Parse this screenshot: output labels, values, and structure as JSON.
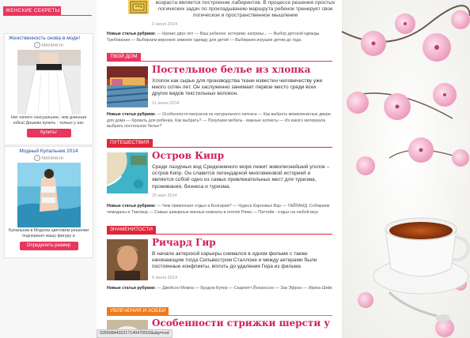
{
  "sidebar": {
    "header": "Женские секреты",
    "ads": [
      {
        "title": "Женственность снова в моде!",
        "source": "lascana.ru",
        "desc": "Нет ничего сексуальнее, чем длинная юбка! Дешево купить - только у нас",
        "button": "Купить!"
      },
      {
        "title": "Модный Купальник 2014",
        "source": "lascana.ru",
        "desc": "Купальник в Модном цветовом решении подчеркнет вашу фигуру и",
        "button": "Определить размер"
      }
    ]
  },
  "main": {
    "intro": {
      "text": "возраста является построение лабиринтов. В процессе решения простых логических задач по прокладыванию маршрута ребенок тренирует свое логическое и пространственное мышление",
      "date": "3 июня 2014",
      "rubrics_label": "Новые статьи рубрики:",
      "rubrics": "— Кризис двух лет — Ваш ребенок: истерики, капризы... — Выбор детской одежды. Требования — Выбираем верхнюю зимнюю одежду для детей — Выбираем игрушки детям до года"
    },
    "articles": [
      {
        "label": "Твой дом",
        "title": "Постельное белье из хлопка",
        "text": "Хлопок как сырье для производства ткани известен человечеству уже много сотен лет. Он заслуженно занимает первое место среди всех других видов текстильных волокон.",
        "date": "11 июня 2014",
        "rubrics_label": "Новые статьи рубрики:",
        "rubrics": "— Особенности матрасов из натурального латекса — Как выбрать межкомнатные двери для дома — Кровать для ребенка. Как выбрать? — Покупаем мебель - важные аспекты — Из какого материала выбрать постельное белье?"
      },
      {
        "label": "Путешествия",
        "title": "Остров Кипр",
        "text": "Среди лазурных вод Средиземного моря лежит живописнейший уголок – остров Кипр. Он славится легендарной многовековой историей и является собой одно из самых привлекательных мест для туризма, проживания, бизнеса и туризма.",
        "date": "25 мая 2014",
        "rubrics_label": "Новые статьи рубрики:",
        "rubrics": "— Чем привлекает отдых в Болгарии? — Чудеса Карловых Вар — ТАЙЛАНД. Собираем чемоданы в Таиланд — Самые шикарные винные комнаты в отелях Рима — Паттайя - отдых на любой вкус"
      },
      {
        "label": "Знаменитости",
        "title": "Ричард Гир",
        "text": "В начале актерской карьеры снимался в одном фильме с также начинающим тогда Сильвестром Сталлоне и между актерами были постоянные конфликты, вплоть до удаления Гира из фильма",
        "date": "9 июня 2014",
        "rubrics_label": "Новые статьи рубрики:",
        "rubrics": "— Джейсон Момоа — Брэдли Купер — Скарлетт Йоханссон — Зак Эфрон — Ирина Шейк"
      },
      {
        "label": "Увлечения и хобби",
        "title": "Особенности стрижки шерсти у"
      }
    ]
  },
  "statusbar": "0265984432217140470502&atg=nod",
  "colors": {
    "pink": "#e8365c",
    "title_pink": "#d0205a",
    "red_label": "#e0263a",
    "orange_label": "#f07a1a"
  }
}
